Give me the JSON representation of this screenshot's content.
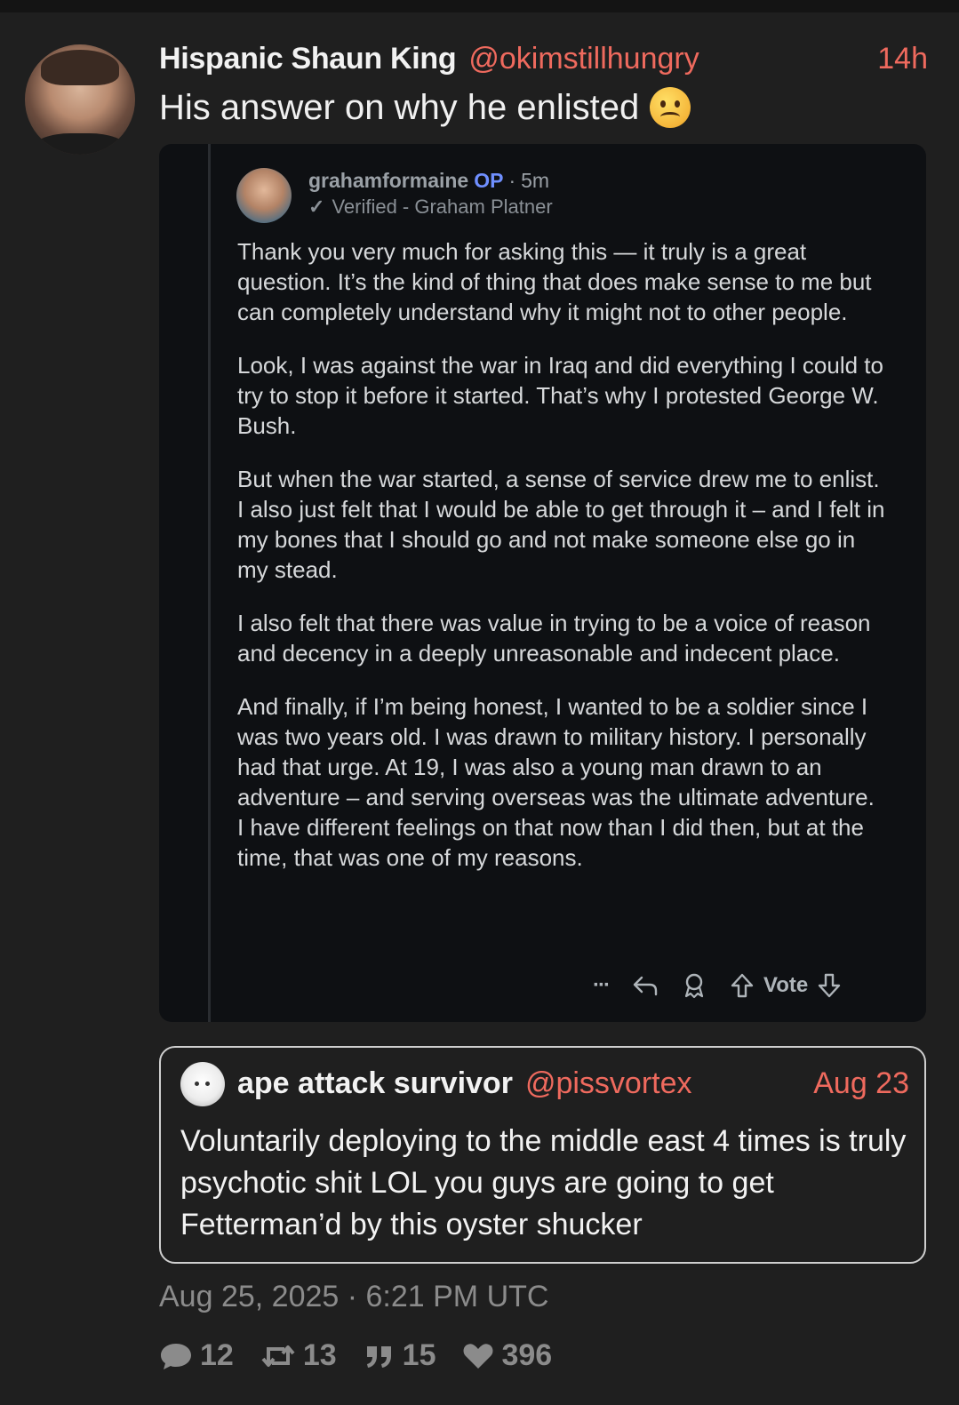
{
  "post": {
    "display_name": "Hispanic Shaun King",
    "handle": "@okimstillhungry",
    "time": "14h",
    "text": "His answer on why he enlisted",
    "emoji": "woozy-face-emoji"
  },
  "screenshot": {
    "username": "grahamformaine",
    "op_badge": "OP",
    "separator": "·",
    "age": "5m",
    "verified": "Verified - Graham Platner",
    "paragraphs": [
      "Thank you very much for asking this — it truly is a great question. It’s the kind of thing that does make sense to me but can completely understand why it might not to other people.",
      "Look, I was against the war in Iraq and did everything I could to try to stop it before it started. That’s why I protested George W. Bush.",
      "But when the war started, a sense of service drew me to enlist. I also just felt that I would be able to get through it – and I felt in my bones that I should go and not make someone else go in my stead.",
      "I also felt that there was value in trying to be a voice of reason and decency in a deeply unreasonable and indecent place.",
      "And finally, if I’m being honest, I wanted to be a soldier since I was two years old. I was drawn to military history. I personally had that urge. At 19, I was also a young man drawn to an adventure – and serving overseas was the ultimate adventure. I have different feelings on that now than I did then, but at the time, that was one of my reasons."
    ],
    "actions": {
      "more": "···",
      "vote_label": "Vote"
    }
  },
  "quote": {
    "display_name": "ape attack survivor",
    "handle": "@pissvortex",
    "date": "Aug 23",
    "text": "Voluntarily deploying to the middle east 4 times is truly psychotic shit LOL you guys are going to get Fetterman’d by this oyster shucker"
  },
  "timestamp": "Aug 25, 2025 · 6:21 PM UTC",
  "stats": {
    "replies": "12",
    "retweets": "13",
    "quotes": "15",
    "likes": "396"
  },
  "colors": {
    "accent": "#ef6a5e",
    "background": "#1f1f1f",
    "op_blue": "#6f8fff"
  }
}
